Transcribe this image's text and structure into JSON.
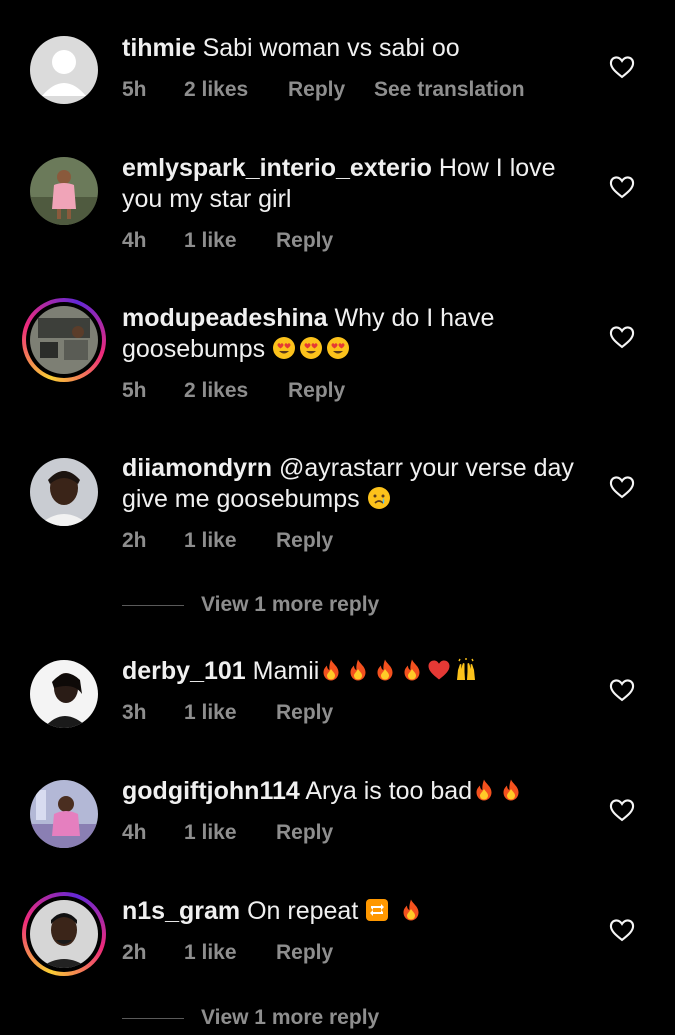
{
  "comments": [
    {
      "username": "tihmie",
      "text": "Sabi woman vs sabi oo",
      "time": "5h",
      "likes": "2 likes",
      "reply": "Reply",
      "extra": "See translation"
    },
    {
      "username": "emlyspark_interio_exterio",
      "text": "How I love you my star girl",
      "time": "4h",
      "likes": "1 like",
      "reply": "Reply"
    },
    {
      "username": "modupeadeshina",
      "text": "Why do I have goosebumps",
      "emojis": [
        "heart-eyes",
        "heart-eyes",
        "heart-eyes"
      ],
      "time": "5h",
      "likes": "2 likes",
      "reply": "Reply"
    },
    {
      "username": "diiamondyrn",
      "text": "@ayrastarr  your verse day give me goosebumps",
      "emojis": [
        "crying-face"
      ],
      "time": "2h",
      "likes": "1 like",
      "reply": "Reply",
      "view_more": "View 1 more reply"
    },
    {
      "username": "derby_101",
      "text": "Mamii",
      "emojis": [
        "fire",
        "fire",
        "fire",
        "fire",
        "red-heart",
        "raising-hands"
      ],
      "time": "3h",
      "likes": "1 like",
      "reply": "Reply"
    },
    {
      "username": "godgiftjohn114",
      "text": "Arya is too bad",
      "emojis": [
        "fire",
        "fire"
      ],
      "time": "4h",
      "likes": "1 like",
      "reply": "Reply"
    },
    {
      "username": "n1s_gram",
      "text": "On repeat",
      "emojis": [
        "repeat-button",
        "fire"
      ],
      "time": "2h",
      "likes": "1 like",
      "reply": "Reply",
      "view_more": "View 1 more reply"
    }
  ],
  "icons": {
    "like": "heart-outline-icon"
  },
  "colors": {
    "background": "#000000",
    "text": "#f0f0f0",
    "muted": "#8e8e8e"
  }
}
